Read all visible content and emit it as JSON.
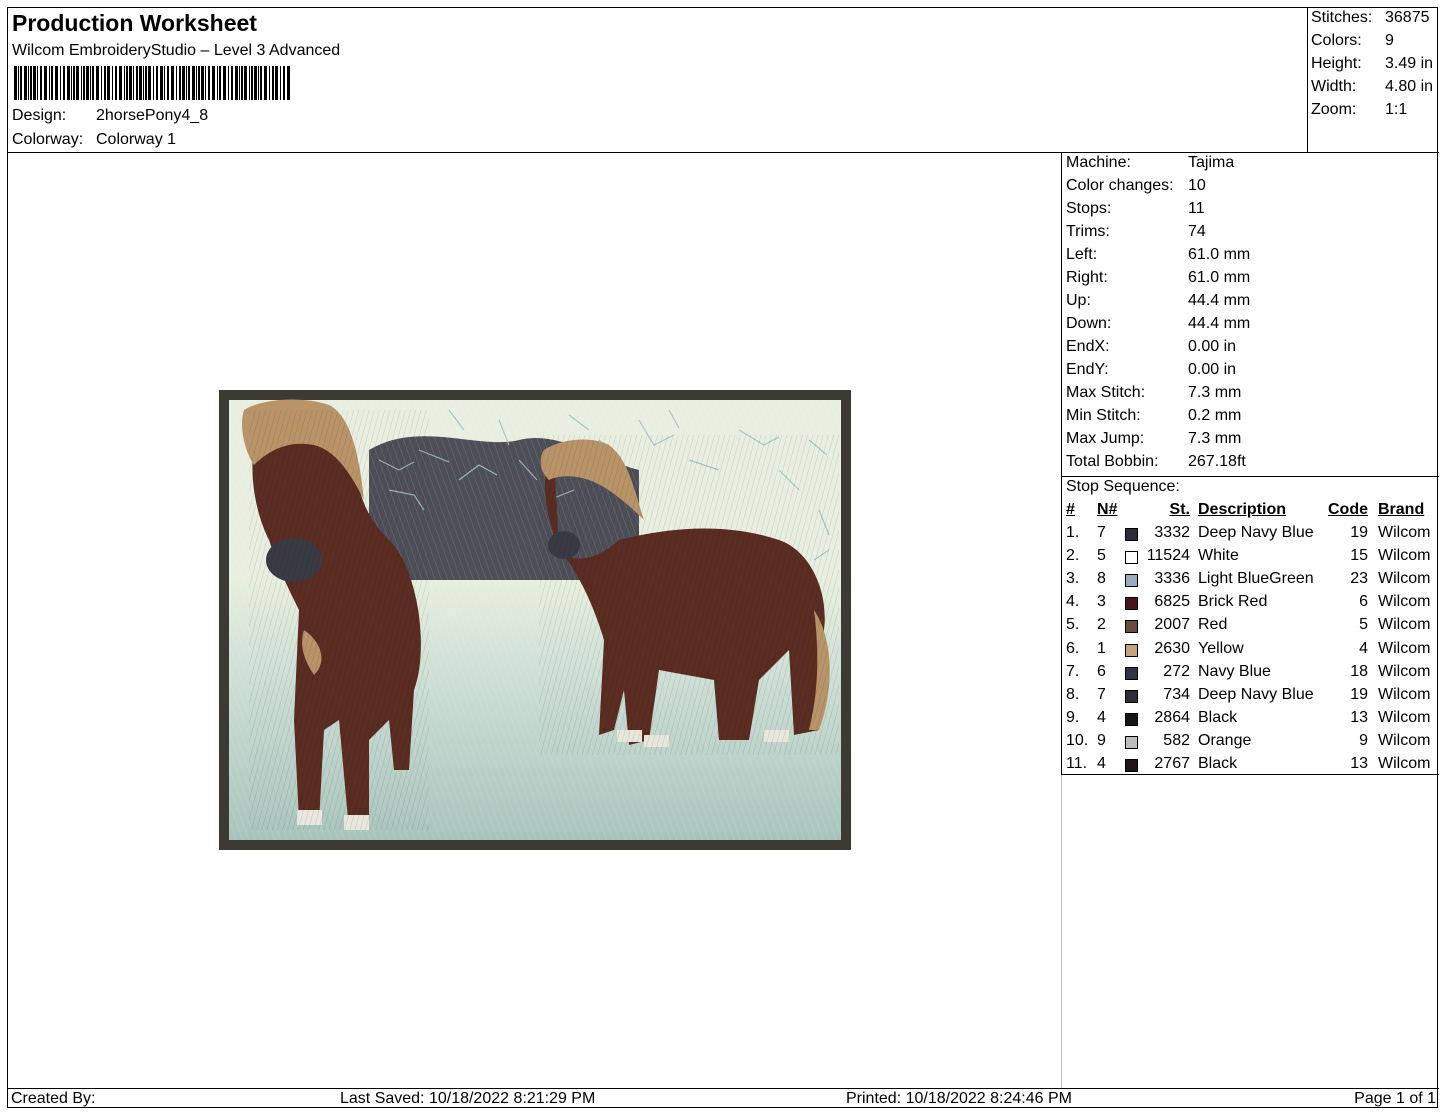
{
  "header": {
    "title": "Production Worksheet",
    "subtitle": "Wilcom EmbroideryStudio – Level 3 Advanced",
    "design_label": "Design:",
    "design_value": "2horsePony4_8",
    "colorway_label": "Colorway:",
    "colorway_value": "Colorway 1"
  },
  "stats": {
    "stitches_label": "Stitches:",
    "stitches": "36875",
    "colors_label": "Colors:",
    "colors": "9",
    "height_label": "Height:",
    "height": "3.49 in",
    "width_label": "Width:",
    "width": "4.80 in",
    "zoom_label": "Zoom:",
    "zoom": "1:1"
  },
  "machine_info": [
    {
      "label": "Machine:",
      "value": "Tajima"
    },
    {
      "label": "Color changes:",
      "value": "10"
    },
    {
      "label": "Stops:",
      "value": "11"
    },
    {
      "label": "Trims:",
      "value": "74"
    },
    {
      "label": "Left:",
      "value": "61.0 mm"
    },
    {
      "label": "Right:",
      "value": "61.0 mm"
    },
    {
      "label": "Up:",
      "value": "44.4 mm"
    },
    {
      "label": "Down:",
      "value": "44.4 mm"
    },
    {
      "label": "EndX:",
      "value": "0.00 in"
    },
    {
      "label": "EndY:",
      "value": "0.00 in"
    },
    {
      "label": "Max Stitch:",
      "value": "7.3 mm"
    },
    {
      "label": "Min Stitch:",
      "value": "0.2 mm"
    },
    {
      "label": "Max Jump:",
      "value": "7.3 mm"
    },
    {
      "label": "Total Bobbin:",
      "value": "267.18ft"
    }
  ],
  "stop_sequence": {
    "title": "Stop Sequence:",
    "headers": {
      "num": "#",
      "n": "N#",
      "st": "St.",
      "desc": "Description",
      "code": "Code",
      "brand": "Brand"
    },
    "rows": [
      {
        "num": "1.",
        "n": "7",
        "color": "#2b2d3a",
        "st": "3332",
        "desc": "Deep Navy Blue",
        "code": "19",
        "brand": "Wilcom"
      },
      {
        "num": "2.",
        "n": "5",
        "color": "#ffffff",
        "st": "11524",
        "desc": "White",
        "code": "15",
        "brand": "Wilcom"
      },
      {
        "num": "3.",
        "n": "8",
        "color": "#98adc0",
        "st": "3336",
        "desc": "Light BlueGreen",
        "code": "23",
        "brand": "Wilcom"
      },
      {
        "num": "4.",
        "n": "3",
        "color": "#4a1418",
        "st": "6825",
        "desc": "Brick Red",
        "code": "6",
        "brand": "Wilcom"
      },
      {
        "num": "5.",
        "n": "2",
        "color": "#6b4a3a",
        "st": "2007",
        "desc": "Red",
        "code": "5",
        "brand": "Wilcom"
      },
      {
        "num": "6.",
        "n": "1",
        "color": "#c6a27c",
        "st": "2630",
        "desc": "Yellow",
        "code": "4",
        "brand": "Wilcom"
      },
      {
        "num": "7.",
        "n": "6",
        "color": "#2f3447",
        "st": "272",
        "desc": "Navy Blue",
        "code": "18",
        "brand": "Wilcom"
      },
      {
        "num": "8.",
        "n": "7",
        "color": "#2b2d3a",
        "st": "734",
        "desc": "Deep Navy Blue",
        "code": "19",
        "brand": "Wilcom"
      },
      {
        "num": "9.",
        "n": "4",
        "color": "#161616",
        "st": "2864",
        "desc": "Black",
        "code": "13",
        "brand": "Wilcom"
      },
      {
        "num": "10.",
        "n": "9",
        "color": "#bdbdbd",
        "st": "582",
        "desc": "Orange",
        "code": "9",
        "brand": "Wilcom"
      },
      {
        "num": "11.",
        "n": "4",
        "color": "#1e1616",
        "st": "2767",
        "desc": "Black",
        "code": "13",
        "brand": "Wilcom"
      }
    ]
  },
  "footer": {
    "created_by": "Created By:",
    "last_saved": "Last Saved: 10/18/2022 8:21:29 PM",
    "printed": "Printed: 10/18/2022 8:24:46 PM",
    "page": "Page 1 of 1"
  },
  "colors": {
    "frame": "#3d3a33",
    "sky": "#e9efe0",
    "ground": "#b6cdc6",
    "hills": "#4e4e58",
    "horse": "#5a2c22",
    "mane": "#b89468"
  }
}
